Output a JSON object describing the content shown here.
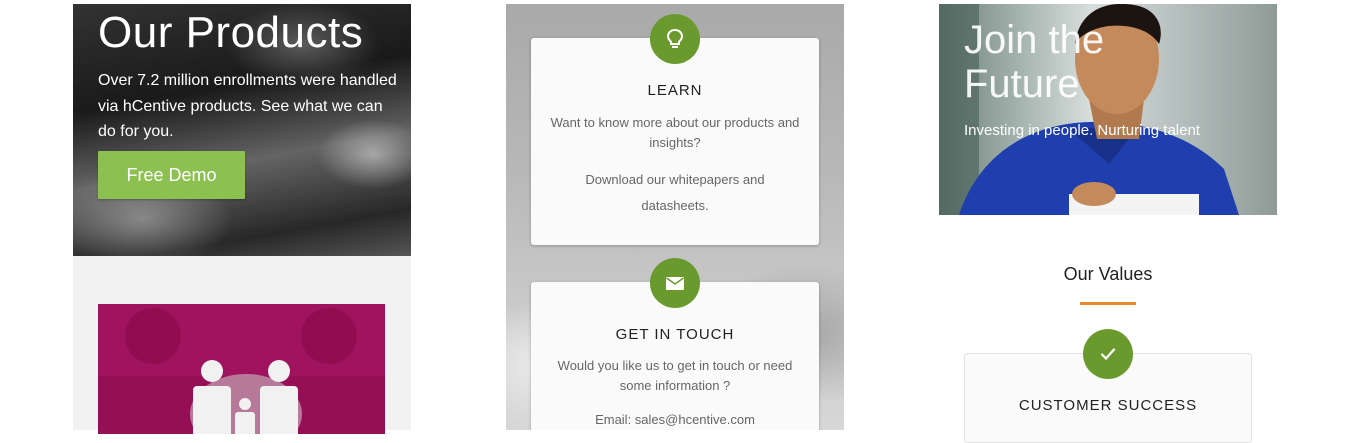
{
  "products": {
    "title": "Our Products",
    "description": "Over 7.2 million enrollments were handled via hCentive products. See what we can do for you.",
    "demo_button": "Free Demo"
  },
  "learn_card": {
    "icon": "lightbulb-icon",
    "heading": "LEARN",
    "text1": "Want to know more about our products and insights?",
    "text2": "Download our whitepapers and datasheets."
  },
  "touch_card": {
    "icon": "envelope-icon",
    "heading": "GET IN TOUCH",
    "text1": "Would you like us to get in touch or need some information ?",
    "text2": "Email: sales@hcentive.com"
  },
  "future": {
    "title": "Join the Future",
    "subtitle": "Investing in people. Nurturing talent"
  },
  "values": {
    "heading": "Our Values",
    "card_icon": "check-icon",
    "card_heading": "CUSTOMER SUCCESS"
  },
  "colors": {
    "accent_green": "#8cc152",
    "icon_green": "#6a9a2d",
    "magenta": "#a0135f",
    "underline_orange": "#e8892b"
  }
}
